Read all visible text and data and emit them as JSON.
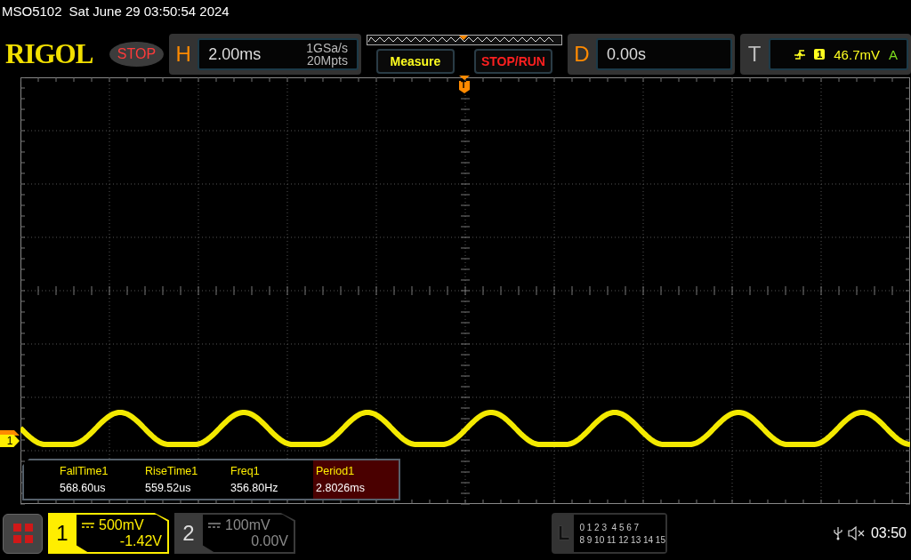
{
  "status_line": {
    "model": "MSO5102",
    "datetime": "Sat June 29 03:50:54 2024"
  },
  "header": {
    "logo": "RIGOL",
    "run_state": "STOP",
    "horizontal": {
      "label": "H",
      "timebase": "2.00ms",
      "sample_rate": "1GSa/s",
      "memory_depth": "20Mpts"
    },
    "buttons": [
      {
        "label": "Measure",
        "kind": "measure"
      },
      {
        "label": "STOP/RUN",
        "kind": "stoprun"
      }
    ],
    "delay": {
      "label": "D",
      "value": "0.00s"
    },
    "trigger": {
      "label": "T",
      "source": "1",
      "level": "46.7mV",
      "mode": "A"
    }
  },
  "display": {
    "trigger_marker": "T",
    "channel_marker": "1"
  },
  "measurements": [
    {
      "name": "FallTime1",
      "value": "568.60us",
      "selected": false
    },
    {
      "name": "RiseTime1",
      "value": "559.52us",
      "selected": false
    },
    {
      "name": "Freq1",
      "value": "356.80Hz",
      "selected": false
    },
    {
      "name": "Period1",
      "value": "2.8026ms",
      "selected": true
    }
  ],
  "channels": [
    {
      "number": "1",
      "scale": "500mV",
      "offset": "-1.42V",
      "active": true
    },
    {
      "number": "2",
      "scale": "100mV",
      "offset": "0.00V",
      "active": false
    }
  ],
  "logic": {
    "label": "L",
    "row_1": "0 1 2 3  4 5 6 7",
    "row_2": "8 9 10 11 12 13 14 15"
  },
  "status_tray": {
    "muted": true,
    "time": "03:50"
  }
}
